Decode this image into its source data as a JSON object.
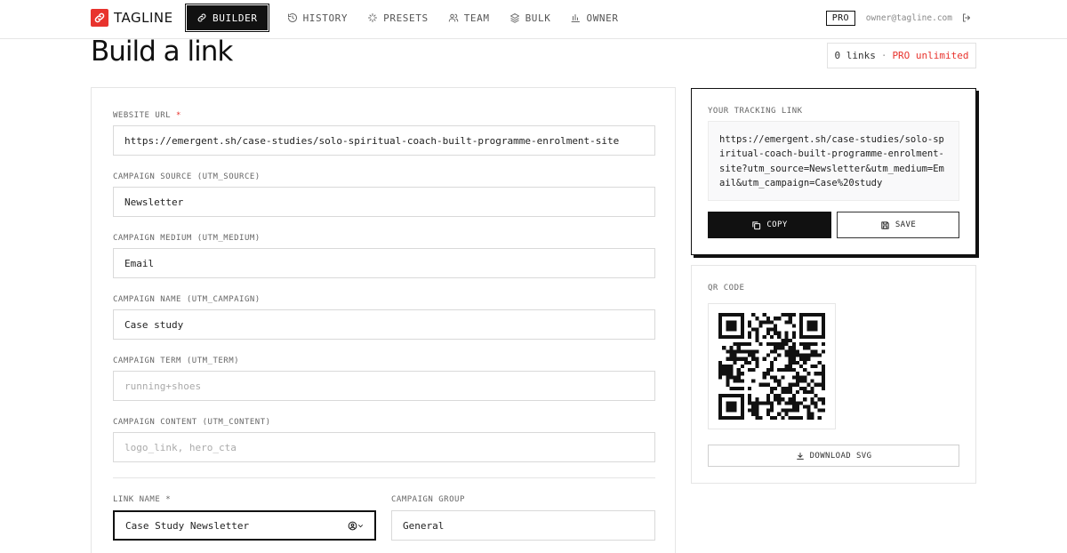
{
  "app": {
    "brand": "TAGLINE",
    "accent_color": "#e8332d"
  },
  "nav": {
    "items": [
      {
        "label": "BUILDER",
        "icon": "link-icon",
        "active": true
      },
      {
        "label": "HISTORY",
        "icon": "history-icon",
        "active": false
      },
      {
        "label": "PRESETS",
        "icon": "sparkle-icon",
        "active": false
      },
      {
        "label": "TEAM",
        "icon": "users-icon",
        "active": false
      },
      {
        "label": "BULK",
        "icon": "layers-icon",
        "active": false
      },
      {
        "label": "OWNER",
        "icon": "bar-chart-icon",
        "active": false
      }
    ],
    "plan_badge": "PRO",
    "user_email": "owner@tagline.com",
    "logout_icon": "logout-icon"
  },
  "page": {
    "title": "Build a link",
    "links_count": "0 links",
    "separator": "·",
    "plan_status": "PRO unlimited"
  },
  "form": {
    "website_url": {
      "label": "WEBSITE URL",
      "required_mark": "*",
      "value": "https://emergent.sh/case-studies/solo-spiritual-coach-built-programme-enrolment-site"
    },
    "utm_source": {
      "label": "CAMPAIGN SOURCE (UTM_SOURCE)",
      "value": "Newsletter"
    },
    "utm_medium": {
      "label": "CAMPAIGN MEDIUM (UTM_MEDIUM)",
      "value": "Email"
    },
    "utm_campaign": {
      "label": "CAMPAIGN NAME (UTM_CAMPAIGN)",
      "value": "Case study"
    },
    "utm_term": {
      "label": "CAMPAIGN TERM (UTM_TERM)",
      "value": "",
      "placeholder": "running+shoes"
    },
    "utm_content": {
      "label": "CAMPAIGN CONTENT (UTM_CONTENT)",
      "value": "",
      "placeholder": "logo_link, hero_cta"
    },
    "link_name": {
      "label": "LINK NAME",
      "required_mark": "*",
      "value": "Case Study Newsletter"
    },
    "campaign_group": {
      "label": "CAMPAIGN GROUP",
      "value": "General"
    }
  },
  "tracking": {
    "label": "YOUR TRACKING LINK",
    "url": "https://emergent.sh/case-studies/solo-spiritual-coach-built-programme-enrolment-site?utm_source=Newsletter&utm_medium=Email&utm_campaign=Case%20study",
    "copy_label": "COPY",
    "save_label": "SAVE"
  },
  "qr": {
    "label": "QR CODE",
    "download_label": "DOWNLOAD SVG"
  }
}
